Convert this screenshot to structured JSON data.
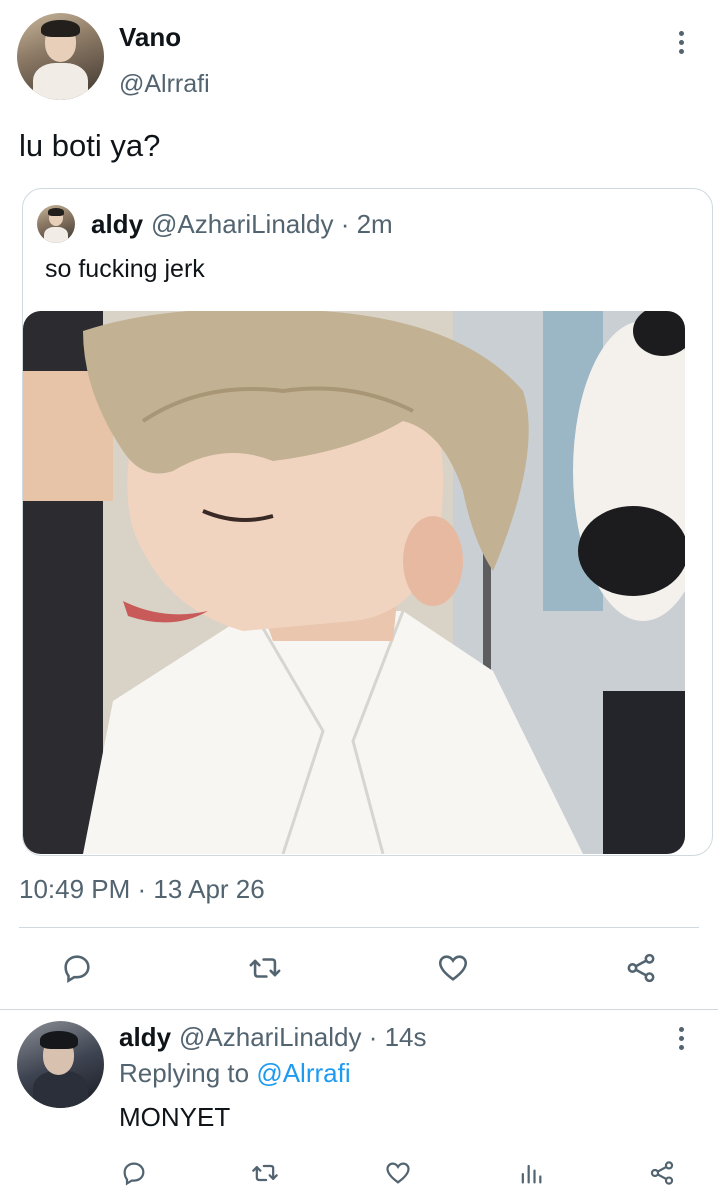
{
  "tweet": {
    "author_name": "Vano",
    "author_handle": "@Alrrafi",
    "text": "lu boti ya?",
    "timestamp": "10:49 PM · 13 Apr 26",
    "avatar_icon": "user-avatar"
  },
  "quote": {
    "author_name": "aldy",
    "author_handle": "@AzhariLinaldy · 2m",
    "text": "so fucking jerk",
    "media_description": "photo"
  },
  "actions": {
    "reply_icon": "reply-icon",
    "retweet_icon": "retweet-icon",
    "like_icon": "heart-icon",
    "share_icon": "share-icon",
    "analytics_icon": "analytics-icon"
  },
  "reply": {
    "author_name": "aldy",
    "author_handle": "@AzhariLinaldy · 14s",
    "replying_prefix": "Replying to ",
    "replying_to": "@Alrrafi",
    "text": "MONYET"
  },
  "colors": {
    "text_primary": "#0f1419",
    "text_secondary": "#536471",
    "accent": "#1d9bf0",
    "border": "#cfd9de"
  }
}
